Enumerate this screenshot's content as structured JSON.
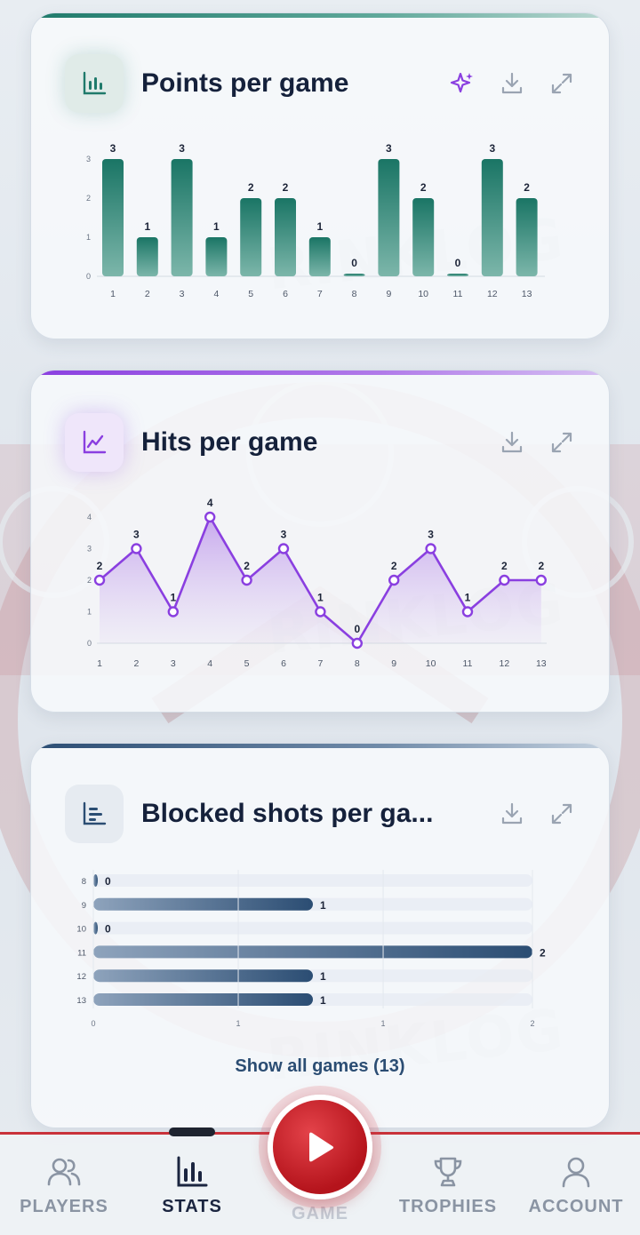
{
  "watermark": "RINKLOG",
  "cards": {
    "points": {
      "title": "Points per game",
      "accent": "#1f7a6b",
      "icon": "bar-chart-icon",
      "actions": [
        "sparkle-icon",
        "download-icon",
        "expand-icon"
      ]
    },
    "hits": {
      "title": "Hits per game",
      "accent": "#8a3fe0",
      "icon": "line-chart-icon",
      "actions": [
        "download-icon",
        "expand-icon"
      ]
    },
    "blocked": {
      "title": "Blocked shots per ga...",
      "accent": "#2b4d73",
      "icon": "horizontal-bar-icon",
      "actions": [
        "download-icon",
        "expand-icon"
      ],
      "show_all": "Show all games (13)"
    }
  },
  "chart_data": [
    {
      "type": "bar",
      "title": "Points per game",
      "categories": [
        "1",
        "2",
        "3",
        "4",
        "5",
        "6",
        "7",
        "8",
        "9",
        "10",
        "11",
        "12",
        "13"
      ],
      "values": [
        3,
        1,
        3,
        1,
        2,
        2,
        1,
        0,
        3,
        2,
        0,
        3,
        2
      ],
      "ylim": [
        0,
        3
      ],
      "yticks": [
        "0",
        "1",
        "2",
        "3"
      ],
      "color": "#1f7a6b"
    },
    {
      "type": "line",
      "title": "Hits per game",
      "categories": [
        "1",
        "2",
        "3",
        "4",
        "5",
        "6",
        "7",
        "8",
        "9",
        "10",
        "11",
        "12",
        "13"
      ],
      "values": [
        2,
        3,
        1,
        4,
        2,
        3,
        1,
        0,
        2,
        3,
        1,
        2,
        2
      ],
      "yticks": [
        "0",
        "1",
        "2",
        "3",
        "4"
      ],
      "color": "#8a3fe0"
    },
    {
      "type": "bar",
      "orientation": "horizontal",
      "title": "Blocked shots per ga...",
      "categories": [
        "8",
        "9",
        "10",
        "11",
        "12",
        "13"
      ],
      "values": [
        0,
        1,
        0,
        2,
        1,
        1
      ],
      "xticks": [
        "0",
        "1",
        "1",
        "2"
      ],
      "xlim": [
        0,
        2
      ],
      "color": "#2b4d73"
    }
  ],
  "nav": {
    "items": [
      {
        "label": "PLAYERS",
        "icon": "players-icon"
      },
      {
        "label": "STATS",
        "icon": "stats-icon"
      },
      {
        "label": "GAME",
        "icon": "play-icon"
      },
      {
        "label": "TROPHIES",
        "icon": "trophy-icon"
      },
      {
        "label": "ACCOUNT",
        "icon": "account-icon"
      }
    ],
    "active": "STATS",
    "accent": "#c9323a"
  }
}
